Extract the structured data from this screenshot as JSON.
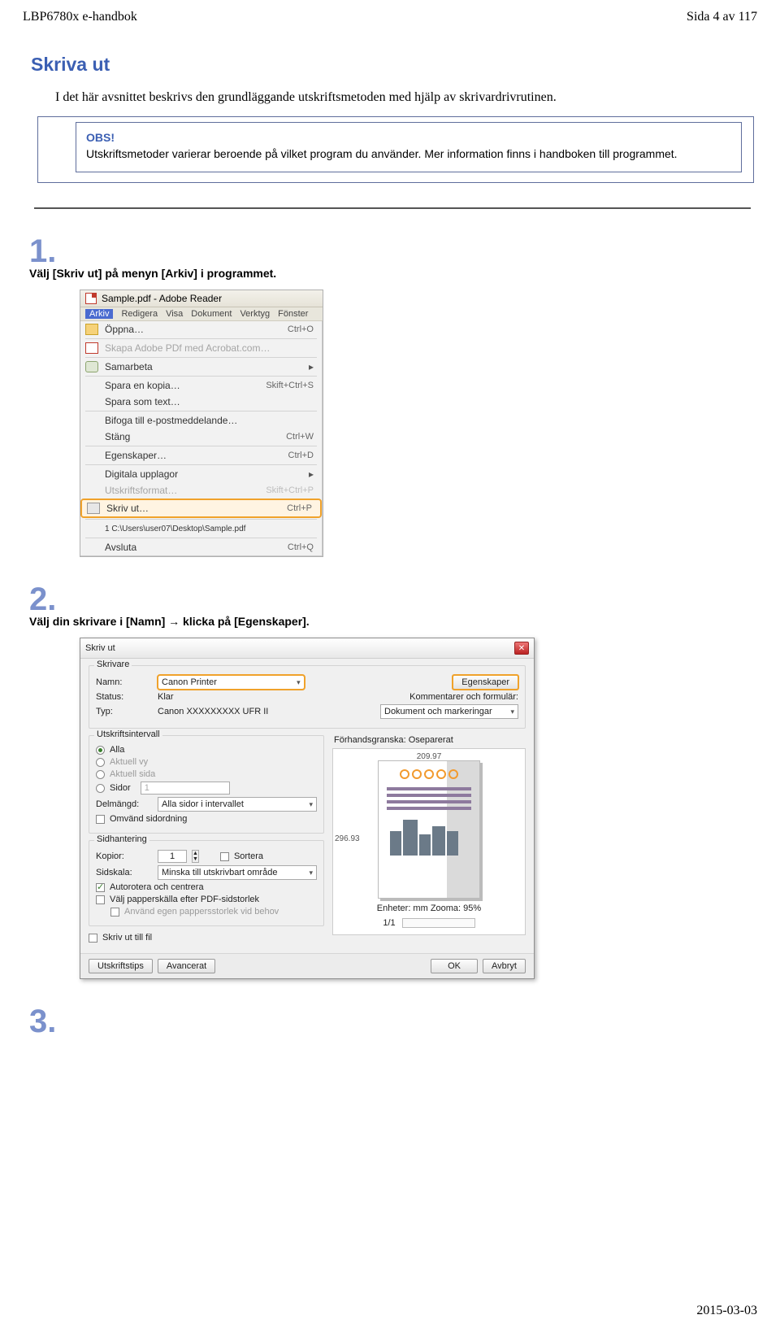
{
  "header": {
    "left": "LBP6780x e-handbok",
    "right": "Sida 4 av 117"
  },
  "title": "Skriva ut",
  "intro": "I det här avsnittet beskrivs den grundläggande utskriftsmetoden med hjälp av skrivardrivrutinen.",
  "obs": {
    "heading": "OBS!",
    "text": "Utskriftsmetoder varierar beroende på vilket program du använder. Mer information finns i handboken till programmet."
  },
  "steps": {
    "s1": {
      "num": "1.",
      "text": "Välj [Skriv ut] på menyn [Arkiv] i programmet."
    },
    "s2": {
      "num": "2.",
      "text": "Välj din skrivare i [Namn] → klicka på [Egenskaper]."
    },
    "s3": {
      "num": "3."
    }
  },
  "menu": {
    "wintitle": "Sample.pdf - Adobe Reader",
    "bar": [
      "Arkiv",
      "Redigera",
      "Visa",
      "Dokument",
      "Verktyg",
      "Fönster"
    ],
    "items": [
      {
        "label": "Öppna…",
        "sc": "Ctrl+O",
        "icon": "folder"
      },
      {
        "label": "Skapa Adobe PDf med Acrobat.com…",
        "dis": true,
        "icon": "pdfs"
      },
      {
        "label": "Samarbeta",
        "arrow": true,
        "icon": "ppl"
      },
      {
        "label": "Spara en kopia…",
        "sc": "Skift+Ctrl+S"
      },
      {
        "label": "Spara som text…"
      },
      {
        "label": "Bifoga till e-postmeddelande…"
      },
      {
        "label": "Stäng",
        "sc": "Ctrl+W"
      },
      {
        "label": "Egenskaper…",
        "sc": "Ctrl+D"
      },
      {
        "label": "Digitala upplagor",
        "arrow": true
      },
      {
        "label": "Utskriftsformat…",
        "sc": "Skift+Ctrl+P",
        "dis": true
      },
      {
        "label": "Skriv ut…",
        "sc": "Ctrl+P",
        "icon": "prn",
        "hl": true
      },
      {
        "label": "1 C:\\Users\\user07\\Desktop\\Sample.pdf"
      },
      {
        "label": "Avsluta",
        "sc": "Ctrl+Q"
      }
    ]
  },
  "dlg": {
    "title": "Skriv ut",
    "grpPrinter": "Skrivare",
    "nameLab": "Namn:",
    "nameVal": "Canon Printer",
    "propBtn": "Egenskaper",
    "statusLab": "Status:",
    "statusVal": "Klar",
    "typeLab": "Typ:",
    "typeVal": "Canon XXXXXXXXX UFR II",
    "commLab": "Kommentarer och formulär:",
    "commVal": "Dokument och markeringar",
    "grpRange": "Utskriftsintervall",
    "optAll": "Alla",
    "optCur": "Aktuell vy",
    "optPg": "Aktuell sida",
    "optSid": "Sidor",
    "sidorVal": "1",
    "subsetLab": "Delmängd:",
    "subsetVal": "Alla sidor i intervallet",
    "revChk": "Omvänd sidordning",
    "grpHand": "Sidhantering",
    "copiesLab": "Kopior:",
    "copiesVal": "1",
    "collate": "Sortera",
    "scaleLab": "Sidskala:",
    "scaleVal": "Minska till utskrivbart område",
    "autoChk": "Autorotera och centrera",
    "pdfChk": "Välj papperskälla efter PDF-sidstorlek",
    "custChk": "Använd egen pappersstorlek vid behov",
    "toFile": "Skriv ut till fil",
    "prevLab": "Förhandsgranska: Oseparerat",
    "width": "209.97",
    "height": "296.93",
    "units": "Enheter: mm  Zooma:  95%",
    "page": "1/1",
    "tips": "Utskriftstips",
    "adv": "Avancerat",
    "ok": "OK",
    "cancel": "Avbryt"
  },
  "footer": "2015-03-03"
}
